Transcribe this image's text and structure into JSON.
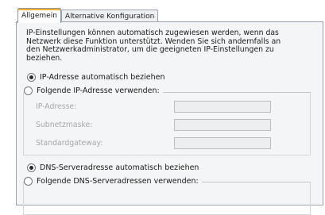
{
  "tabs": [
    {
      "label": "Allgemein",
      "active": true
    },
    {
      "label": "Alternative Konfiguration",
      "active": false
    }
  ],
  "description": [
    "IP-Einstellungen können automatisch zugewiesen werden, wenn das",
    "Netzwerk diese Funktion unterstützt. Wenden Sie sich andernfalls an",
    "den Netzwerkadministrator, um die geeigneten IP-Einstellungen zu",
    "beziehen."
  ],
  "ip_options": {
    "auto_label": "IP-Adresse automatisch beziehen",
    "auto_checked": true,
    "manual_label": "Folgende IP-Adresse verwenden:",
    "manual_checked": false
  },
  "ip_fields": [
    {
      "label": "IP-Adresse:",
      "value": ""
    },
    {
      "label": "Subnetzmaske:",
      "value": ""
    },
    {
      "label": "Standardgateway:",
      "value": ""
    }
  ],
  "dns_options": {
    "auto_label": "DNS-Serveradresse automatisch beziehen",
    "auto_checked": true,
    "manual_label": "Folgende DNS-Serveradressen verwenden:",
    "manual_checked": false
  }
}
